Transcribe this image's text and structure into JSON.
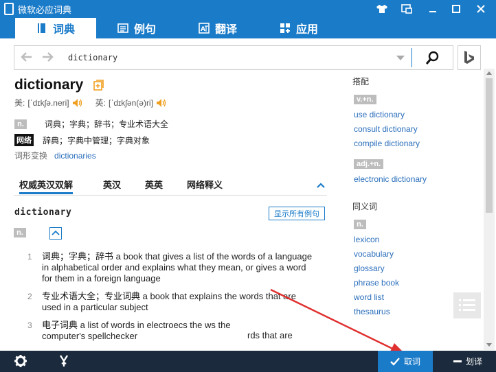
{
  "app": {
    "title": "微软必应词典"
  },
  "nav": {
    "tabs": [
      {
        "label": "词典"
      },
      {
        "label": "例句"
      },
      {
        "label": "翻译"
      },
      {
        "label": "应用"
      }
    ]
  },
  "search": {
    "value": "dictionary"
  },
  "entry": {
    "headword": "dictionary",
    "phon_us_label": "美:",
    "phon_us": "[ˈdɪkʃə.neri]",
    "phon_uk_label": "英:",
    "phon_uk": "[ˈdɪkʃən(ə)ri]",
    "defs": [
      {
        "pos": "n.",
        "text": "词典；字典；辞书；专业术语大全"
      },
      {
        "pos": "网络",
        "text": "辞典；字典中管理；字典对象"
      }
    ],
    "forms_label": "词形变换",
    "forms_value": "dictionaries"
  },
  "sub_tabs": [
    {
      "label": "权威英汉双解"
    },
    {
      "label": "英汉"
    },
    {
      "label": "英英"
    },
    {
      "label": "网络释义"
    }
  ],
  "bilingual": {
    "word": "dictionary",
    "show_examples": "显示所有例句",
    "pos": "n.",
    "senses": [
      {
        "num": "1",
        "cn": "词典；字典；辞书",
        "en": " a book that gives a list of the words of a language in alphabetical order and explains what they mean, or gives a word for them in a foreign language"
      },
      {
        "num": "2",
        "cn": "专业术语大全；专业词典",
        "en": " a book that explains the words that are used in a particular subject"
      },
      {
        "num": "3",
        "cn": "电子词典",
        "en": " a list of words in electroecs the ws the",
        "en2": "computer's spellchecker"
      }
    ],
    "overlay_text": "rds that are"
  },
  "collocations": {
    "title": "搭配",
    "groups": [
      {
        "pos": "v.+n.",
        "items": [
          "use dictionary",
          "consult dictionary",
          "compile dictionary"
        ]
      },
      {
        "pos": "adj.+n.",
        "items": [
          "electronic dictionary"
        ]
      }
    ]
  },
  "synonyms": {
    "title": "同义词",
    "pos": "n.",
    "items": [
      "lexicon",
      "vocabulary",
      "glossary",
      "phrase book",
      "word list",
      "thesaurus"
    ]
  },
  "bottom": {
    "pick_label": "取词",
    "translate_label": "划译"
  },
  "colors": {
    "accent": "#1a7bc9",
    "bottom_bar": "#1b2a3c",
    "link": "#2a6ebb",
    "annotation": "#e03030"
  }
}
